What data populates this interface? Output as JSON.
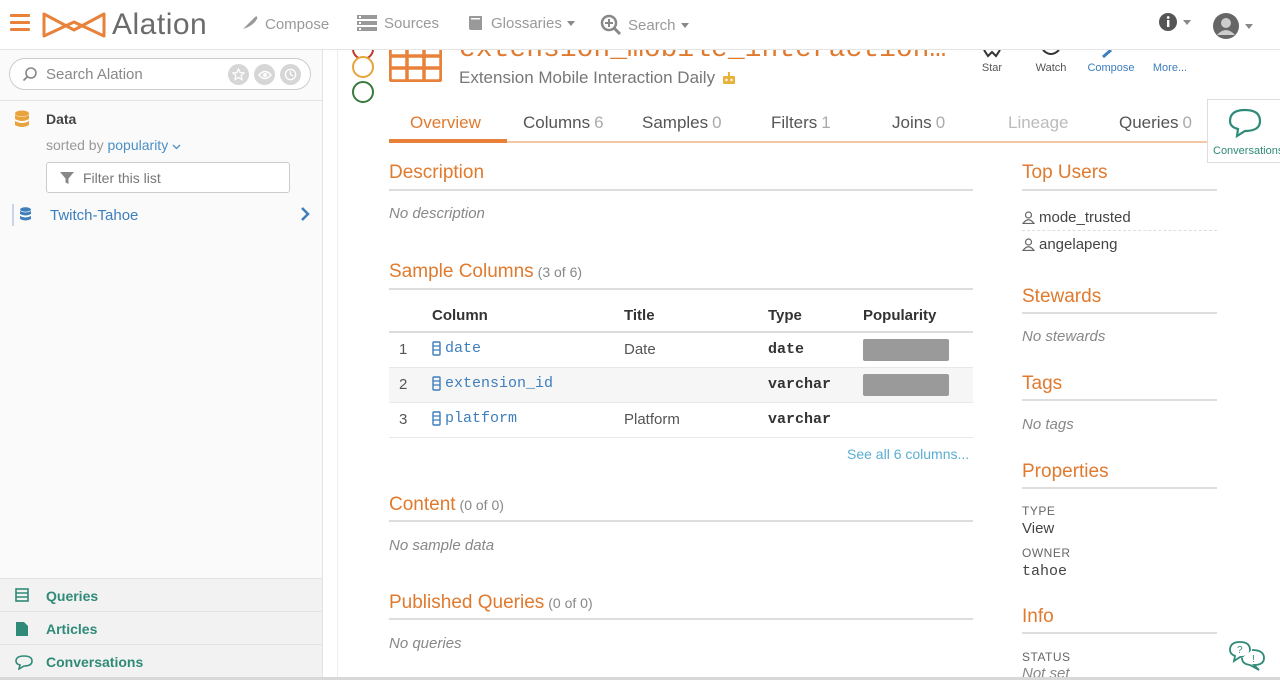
{
  "nav": {
    "brand": "Alation",
    "links": [
      {
        "label": "Compose"
      },
      {
        "label": "Sources"
      },
      {
        "label": "Glossaries"
      },
      {
        "label": "Search"
      }
    ]
  },
  "sidebar": {
    "search_placeholder": "Search Alation",
    "section_title": "Data",
    "sorted_prefix": "sorted by",
    "sorted_value": "popularity",
    "filter_placeholder": "Filter this list",
    "items": [
      {
        "label": "Twitch-Tahoe"
      }
    ],
    "bottom": [
      {
        "label": "Queries"
      },
      {
        "label": "Articles"
      },
      {
        "label": "Conversations"
      }
    ]
  },
  "header": {
    "title": "extension_mobile_interaction…",
    "subtitle": "Extension Mobile Interaction Daily",
    "actions": [
      {
        "label": "Star"
      },
      {
        "label": "Watch"
      },
      {
        "label": "Compose"
      },
      {
        "label": "More..."
      }
    ]
  },
  "tabs": [
    {
      "label": "Overview",
      "count": ""
    },
    {
      "label": "Columns",
      "count": "6"
    },
    {
      "label": "Samples",
      "count": "0"
    },
    {
      "label": "Filters",
      "count": "1"
    },
    {
      "label": "Joins",
      "count": "0"
    },
    {
      "label": "Lineage",
      "count": ""
    },
    {
      "label": "Queries",
      "count": "0"
    }
  ],
  "description": {
    "title": "Description",
    "empty": "No description"
  },
  "sample_columns": {
    "title": "Sample Columns",
    "count": "(3 of 6)",
    "headers": [
      "Column",
      "Title",
      "Type",
      "Popularity"
    ],
    "rows": [
      {
        "num": "1",
        "name": "date",
        "title": "Date",
        "type": "date",
        "popularity": 0.9
      },
      {
        "num": "2",
        "name": "extension_id",
        "title": "",
        "type": "varchar",
        "popularity": 0.9
      },
      {
        "num": "3",
        "name": "platform",
        "title": "Platform",
        "type": "varchar",
        "popularity": 0
      }
    ],
    "see_all": "See all 6 columns..."
  },
  "content": {
    "title": "Content",
    "count": "(0 of 0)",
    "empty": "No sample data"
  },
  "published_queries": {
    "title": "Published Queries",
    "count": "(0 of 0)",
    "empty": "No queries"
  },
  "right": {
    "top_users_title": "Top Users",
    "users": [
      "mode_trusted",
      "angelapeng"
    ],
    "stewards_title": "Stewards",
    "stewards_empty": "No stewards",
    "tags_title": "Tags",
    "tags_empty": "No tags",
    "properties_title": "Properties",
    "type_label": "TYPE",
    "type_value": "View",
    "owner_label": "OWNER",
    "owner_value": "tahoe",
    "info_title": "Info",
    "status_label": "STATUS",
    "status_value": "Not set"
  },
  "conversations_panel": {
    "label": "Conversations"
  },
  "colors": {
    "accent": "#e07a2e",
    "link": "#3d7ebb",
    "teal": "#2f8a78"
  }
}
